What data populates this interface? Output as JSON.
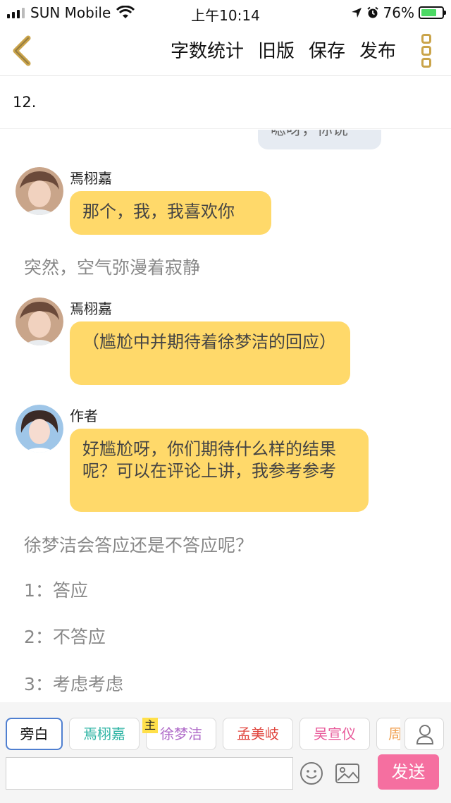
{
  "status_bar": {
    "carrier": "SUN Mobile",
    "time": "上午10:14",
    "battery": "76%",
    "battery_level": 0.76
  },
  "nav": {
    "back_icon": "chevron-left-icon",
    "actions": [
      "字数统计",
      "旧版",
      "保存",
      "发布"
    ],
    "more_icon": "more-vertical-icon",
    "accent_color": "#caa44a"
  },
  "chapter": {
    "title": "12."
  },
  "partial_bubble_text": "嗯呀，你说",
  "messages": [
    {
      "speaker": "焉栩嘉",
      "text": "那个，我，我喜欢你",
      "avatar": "avatar-yan-xujia"
    },
    {
      "narration": "突然，空气弥漫着寂静"
    },
    {
      "speaker": "焉栩嘉",
      "text": "（尴尬中并期待着徐梦洁的回应）",
      "avatar": "avatar-yan-xujia"
    },
    {
      "speaker": "作者",
      "text": "好尴尬呀，你们期待什么样的结果呢？可以在评论上讲，我参考参考",
      "avatar": "avatar-author"
    },
    {
      "narration": "徐梦洁会答应还是不答应呢？"
    },
    {
      "narration": "1：答应"
    },
    {
      "narration": "2：不答应"
    },
    {
      "narration": "3：考虑考虑"
    }
  ],
  "role_chips": [
    {
      "label": "旁白",
      "color": "#111111",
      "active": true
    },
    {
      "label": "焉栩嘉",
      "color": "#2bb3a3",
      "active": false
    },
    {
      "label": "徐梦洁",
      "color": "#b06cc9",
      "active": false,
      "tag": "主"
    },
    {
      "label": "孟美岐",
      "color": "#e0453d",
      "active": false
    },
    {
      "label": "吴宣仪",
      "color": "#e85a9a",
      "active": false
    },
    {
      "label": "周",
      "color": "#f0a050",
      "active": false
    }
  ],
  "input": {
    "placeholder": "",
    "send_label": "发送",
    "send_color": "#f56fa0"
  },
  "bubble_color": "#ffd96a"
}
